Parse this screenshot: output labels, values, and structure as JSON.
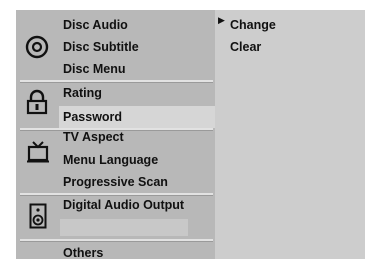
{
  "menu": {
    "groups": [
      {
        "items": [
          "Disc Audio",
          "Disc Subtitle",
          "Disc Menu"
        ],
        "icon": "disc-icon"
      },
      {
        "items": [
          "Rating",
          "Password"
        ],
        "icon": "padlock-icon"
      },
      {
        "items": [
          "TV Aspect",
          "Menu Language",
          "Progressive Scan"
        ],
        "icon": "tv-icon"
      },
      {
        "items": [
          "Digital Audio Output"
        ],
        "icon": "speaker-icon"
      },
      {
        "items": [
          "Others"
        ]
      }
    ],
    "selected": "Password"
  },
  "submenu": {
    "items": [
      "Change",
      "Clear"
    ],
    "selected": "Change",
    "pointer": "▶"
  },
  "colors": {
    "panel": "#b8b8b8",
    "submenu_bg": "#cdcdcd",
    "highlight": "#d6d6d6",
    "text": "#111111"
  }
}
